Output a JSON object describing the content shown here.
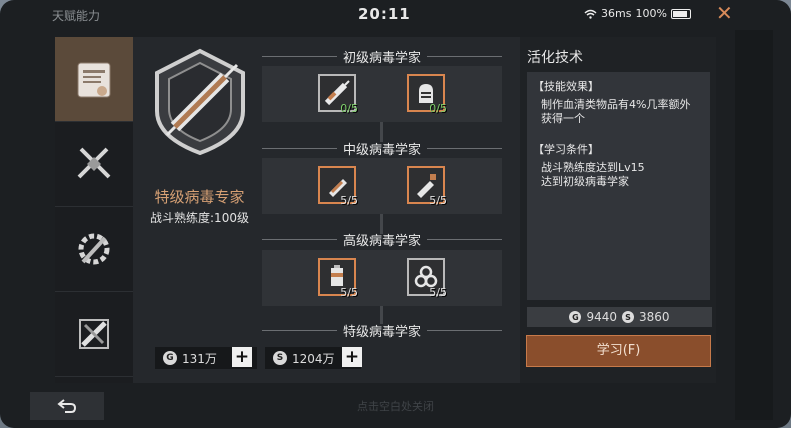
{
  "header": {
    "title": "天赋能力",
    "time": "20:11",
    "ping": "36ms",
    "battery": "100%"
  },
  "profession": {
    "title": "特级病毒专家",
    "level": "战斗熟练度:100级"
  },
  "currency": [
    {
      "icon": "G",
      "amount": "131万"
    },
    {
      "icon": "S",
      "amount": "1204万"
    }
  ],
  "tiers": [
    {
      "name": "初级病毒学家",
      "skills": [
        {
          "count": "0/5",
          "icon": "syringe-icon"
        },
        {
          "count": "0/5",
          "icon": "glove-icon"
        }
      ]
    },
    {
      "name": "中级病毒学家",
      "skills": [
        {
          "count": "5/5",
          "icon": "vial-icon"
        },
        {
          "count": "5/5",
          "icon": "spray-icon"
        }
      ]
    },
    {
      "name": "高级病毒学家",
      "skills": [
        {
          "count": "5/5",
          "icon": "canister-icon"
        },
        {
          "count": "5/5",
          "icon": "biohazard-icon"
        }
      ]
    },
    {
      "name": "特级病毒学家",
      "skills": []
    }
  ],
  "info": {
    "title": "活化技术",
    "effect_header": "【技能效果】",
    "effect_text": "制作血清类物品有4%几率额外获得一个",
    "cond_header": "【学习条件】",
    "cond_1": "战斗熟练度达到Lv15",
    "cond_2": "达到初级病毒学家",
    "cost_g": "9440",
    "cost_s": "3860",
    "learn_label": "学习(F)"
  },
  "hint": "点击空白处关闭",
  "colors": {
    "accent": "#d9864f",
    "button": "#8a4e2c",
    "count_zero": "#7fd06b"
  }
}
